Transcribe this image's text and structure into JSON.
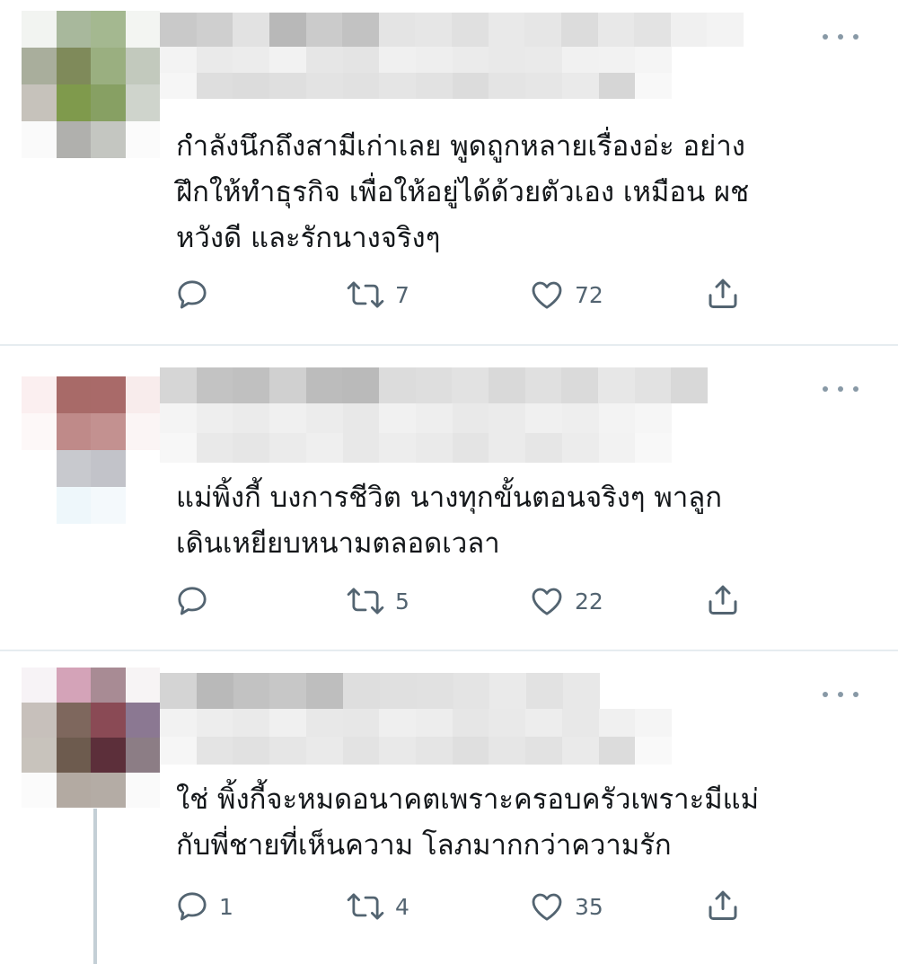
{
  "colors": {
    "icon": "#536471",
    "divider": "#e6ecf0",
    "thread_line": "#c4cfd6"
  },
  "tweets": [
    {
      "text": "กำลังนึกถึงสามีเก่าเลย พูดถูกหลายเรื่องอ่ะ อย่าง\nฝึกให้ทำธุรกิจ เพื่อให้อยู่ได้ด้วยตัวเอง เหมือน ผช\nหวังดี และรักนางจริงๆ",
      "reply_count": "",
      "retweet_count": "7",
      "like_count": "72",
      "icons": [
        "reply-icon",
        "retweet-icon",
        "like-icon",
        "share-icon",
        "more-icon"
      ]
    },
    {
      "text": "แม่พิ้งกี้ บงการชีวิต นางทุกขั้นตอนจริงๆ พาลูก\nเดินเหยียบหนามตลอดเวลา",
      "reply_count": "",
      "retweet_count": "5",
      "like_count": "22",
      "icons": [
        "reply-icon",
        "retweet-icon",
        "like-icon",
        "share-icon",
        "more-icon"
      ]
    },
    {
      "text": "ใช่ พิ้งกี้จะหมดอนาคตเพราะครอบครัวเพราะมีแม่\nกับพี่ชายที่เห็นความ โลภมากกว่าความรัก",
      "reply_count": "1",
      "retweet_count": "4",
      "like_count": "35",
      "icons": [
        "reply-icon",
        "retweet-icon",
        "like-icon",
        "share-icon",
        "more-icon"
      ]
    }
  ]
}
